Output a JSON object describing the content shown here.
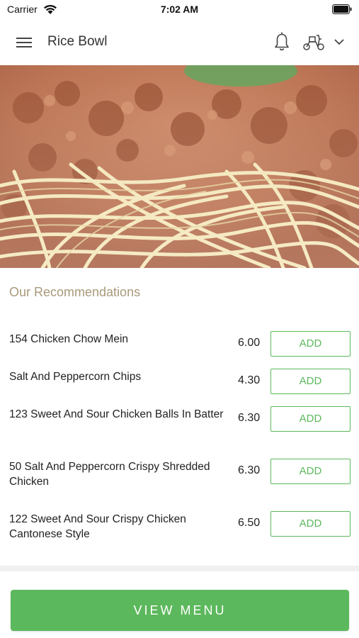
{
  "status_bar": {
    "carrier": "Carrier",
    "time": "7:02 AM"
  },
  "nav": {
    "title": "Rice Bowl",
    "menu_icon": "hamburger-menu-icon",
    "notification_icon": "bell-icon",
    "delivery_icon": "scooter-icon",
    "dropdown_icon": "chevron-down-icon"
  },
  "hero": {
    "image": "spaghetti-bolognese-photo"
  },
  "recommendations": {
    "title": "Our Recommendations",
    "items": [
      {
        "name": "154 Chicken Chow Mein",
        "price": "6.00",
        "action": "ADD"
      },
      {
        "name": "Salt And Peppercorn Chips",
        "price": "4.30",
        "action": "ADD"
      },
      {
        "name": "123 Sweet And Sour Chicken Balls In Batter",
        "price": "6.30",
        "action": "ADD"
      },
      {
        "name": "50 Salt And Peppercorn Crispy Shredded Chicken",
        "price": "6.30",
        "action": "ADD"
      },
      {
        "name": "122 Sweet And Sour Crispy Chicken Cantonese Style",
        "price": "6.50",
        "action": "ADD"
      }
    ]
  },
  "footer": {
    "view_menu_label": "VIEW MENU"
  },
  "colors": {
    "accent_green": "#5cb85c",
    "section_title": "#a8997a"
  }
}
